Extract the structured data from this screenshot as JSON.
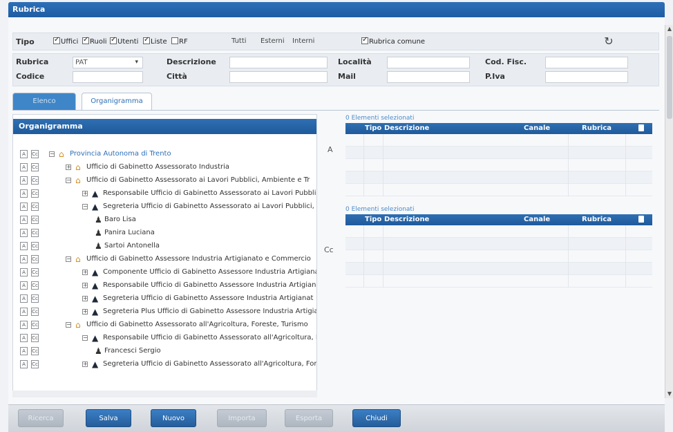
{
  "window": {
    "title": "Rubrica"
  },
  "filters": {
    "tipo_label": "Tipo",
    "checkboxes": [
      {
        "label": "Uffici",
        "checked": true
      },
      {
        "label": "Ruoli",
        "checked": true
      },
      {
        "label": "Utenti",
        "checked": true
      },
      {
        "label": "Liste",
        "checked": true
      },
      {
        "label": "RF",
        "checked": false
      }
    ],
    "radios": [
      "Tutti",
      "Esterni",
      "Interni"
    ],
    "rubrica_comune": {
      "label": "Rubrica comune",
      "checked": true
    }
  },
  "search": {
    "rubrica_label": "Rubrica",
    "rubrica_value": "PAT",
    "descrizione_label": "Descrizione",
    "localita_label": "Località",
    "codfisc_label": "Cod. Fisc.",
    "codice_label": "Codice",
    "citta_label": "Città",
    "mail_label": "Mail",
    "piva_label": "P.Iva"
  },
  "tabs": {
    "elenco": "Elenco",
    "organigramma": "Organigramma"
  },
  "organigramma": {
    "header": "Organigramma",
    "nodes": [
      {
        "text": "Provincia Autonoma di Trento",
        "kind": "home",
        "exp": "⊟",
        "level": 0
      },
      {
        "text": "Ufficio di Gabinetto Assessorato Industria",
        "kind": "home",
        "exp": "⊞",
        "level": 1
      },
      {
        "text": "Ufficio di Gabinetto Assessorato ai Lavori Pubblici, Ambiente e Tr",
        "kind": "home",
        "exp": "⊟",
        "level": 1
      },
      {
        "text": "Responsabile Ufficio di Gabinetto Assessorato ai Lavori Pubblic",
        "kind": "role",
        "exp": "⊞",
        "level": 2
      },
      {
        "text": "Segreteria Ufficio di Gabinetto Assessorato ai Lavori Pubblici,",
        "kind": "role",
        "exp": "⊟",
        "level": 2
      },
      {
        "text": "Baro Lisa",
        "kind": "user",
        "exp": "",
        "level": 3
      },
      {
        "text": "Panira  Luciana",
        "kind": "user",
        "exp": "",
        "level": 3
      },
      {
        "text": "Sartoi Antonella",
        "kind": "user",
        "exp": "",
        "level": 3
      },
      {
        "text": "Ufficio di Gabinetto Assessore Industria Artigianato e Commercio",
        "kind": "home",
        "exp": "⊟",
        "level": 1
      },
      {
        "text": "Componente Ufficio di Gabinetto Assessore Industria Artigiana",
        "kind": "role",
        "exp": "⊞",
        "level": 2
      },
      {
        "text": "Responsabile Ufficio di Gabinetto Assessore Industria Artigian",
        "kind": "role",
        "exp": "⊞",
        "level": 2
      },
      {
        "text": "Segreteria Ufficio di Gabinetto Assessore Industria Artigianat",
        "kind": "role",
        "exp": "⊞",
        "level": 2
      },
      {
        "text": "Segreteria Plus Ufficio di Gabinetto Assessore Industria Artigia",
        "kind": "role",
        "exp": "⊞",
        "level": 2
      },
      {
        "text": "Ufficio di Gabinetto Assessorato all'Agricoltura, Foreste, Turismo",
        "kind": "home",
        "exp": "⊟",
        "level": 1
      },
      {
        "text": "Responsabile Ufficio di Gabinetto Assessorato all'Agricoltura, F",
        "kind": "role",
        "exp": "⊟",
        "level": 2
      },
      {
        "text": "Francesci Sergio",
        "kind": "user",
        "exp": "",
        "level": 3
      },
      {
        "text": "Segreteria Ufficio di Gabinetto Assessorato all'Agricoltura, For",
        "kind": "role",
        "exp": "⊞",
        "level": 2
      }
    ]
  },
  "recipients": {
    "a_label": "A",
    "cc_label": "Cc",
    "count_text_a": "0 Elementi selezionati",
    "count_text_cc": "0 Elementi selezionati",
    "col_tipo": "Tipo",
    "col_descrizione": "Descrizione",
    "col_canale": "Canale",
    "col_rubrica": "Rubrica"
  },
  "buttons": {
    "ricerca": "Ricerca",
    "salva": "Salva",
    "nuovo": "Nuovo",
    "importa": "Importa",
    "esporta": "Esporta",
    "chiudi": "Chiudi"
  }
}
